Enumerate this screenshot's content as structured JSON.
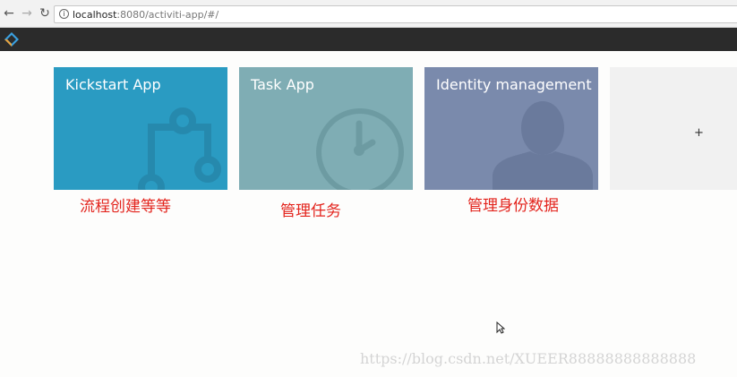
{
  "browser": {
    "url_host": "localhost",
    "url_rest": ":8080/activiti-app/#/",
    "back_icon": "arrow-left",
    "forward_icon": "arrow-right",
    "reload_icon": "reload",
    "info_icon": "info"
  },
  "header": {
    "logo_icon": "activiti-diamond-logo"
  },
  "tiles": [
    {
      "title": "Kickstart App",
      "icon": "process-flow-icon",
      "color": "#2a9bc2"
    },
    {
      "title": "Task App",
      "icon": "clock-icon",
      "color": "#7fadb4"
    },
    {
      "title": "Identity management",
      "icon": "person-icon",
      "color": "#7a8aac"
    }
  ],
  "add_tile": {
    "label": "+"
  },
  "annotations": [
    "流程创建等等",
    "管理任务",
    "管理身份数据"
  ],
  "watermark": "https://blog.csdn.net/XUEER88888888888888",
  "colors": {
    "annotation": "#e3241d",
    "header": "#2b2b2b"
  }
}
